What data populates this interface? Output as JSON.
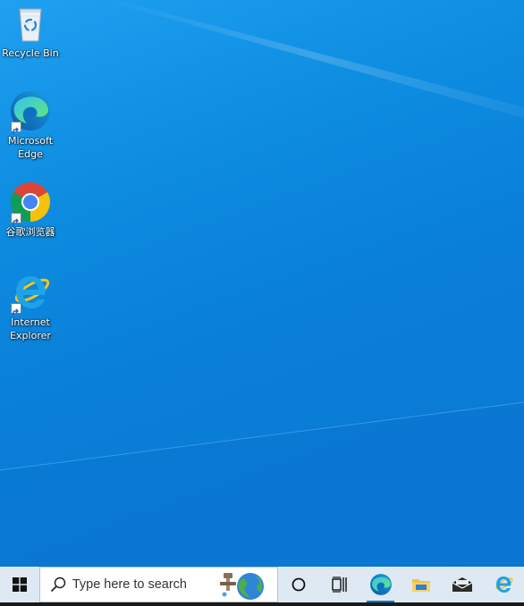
{
  "desktop": {
    "icons": [
      {
        "label": "Recycle Bin",
        "icon": "recycle-bin-icon"
      },
      {
        "label": "Microsoft Edge",
        "icon": "edge-icon"
      },
      {
        "label": "谷歌浏览器",
        "icon": "chrome-icon"
      },
      {
        "label": "Internet Explorer",
        "icon": "internet-explorer-icon"
      }
    ],
    "wallpaper_color": "#0b80d9"
  },
  "taskbar": {
    "start_icon": "windows-logo-icon",
    "search": {
      "placeholder": "Type here to search",
      "icon": "search-icon"
    },
    "buttons": [
      {
        "name": "cortana",
        "icon": "circle-icon"
      },
      {
        "name": "task-view",
        "icon": "task-view-icon"
      },
      {
        "name": "edge",
        "icon": "edge-icon",
        "active": true
      },
      {
        "name": "file-explorer",
        "icon": "folder-icon"
      },
      {
        "name": "mail",
        "icon": "mail-icon"
      },
      {
        "name": "internet-explorer",
        "icon": "internet-explorer-icon"
      }
    ],
    "accent_color": "#0078d7",
    "background_color": "#dfe9f3"
  }
}
